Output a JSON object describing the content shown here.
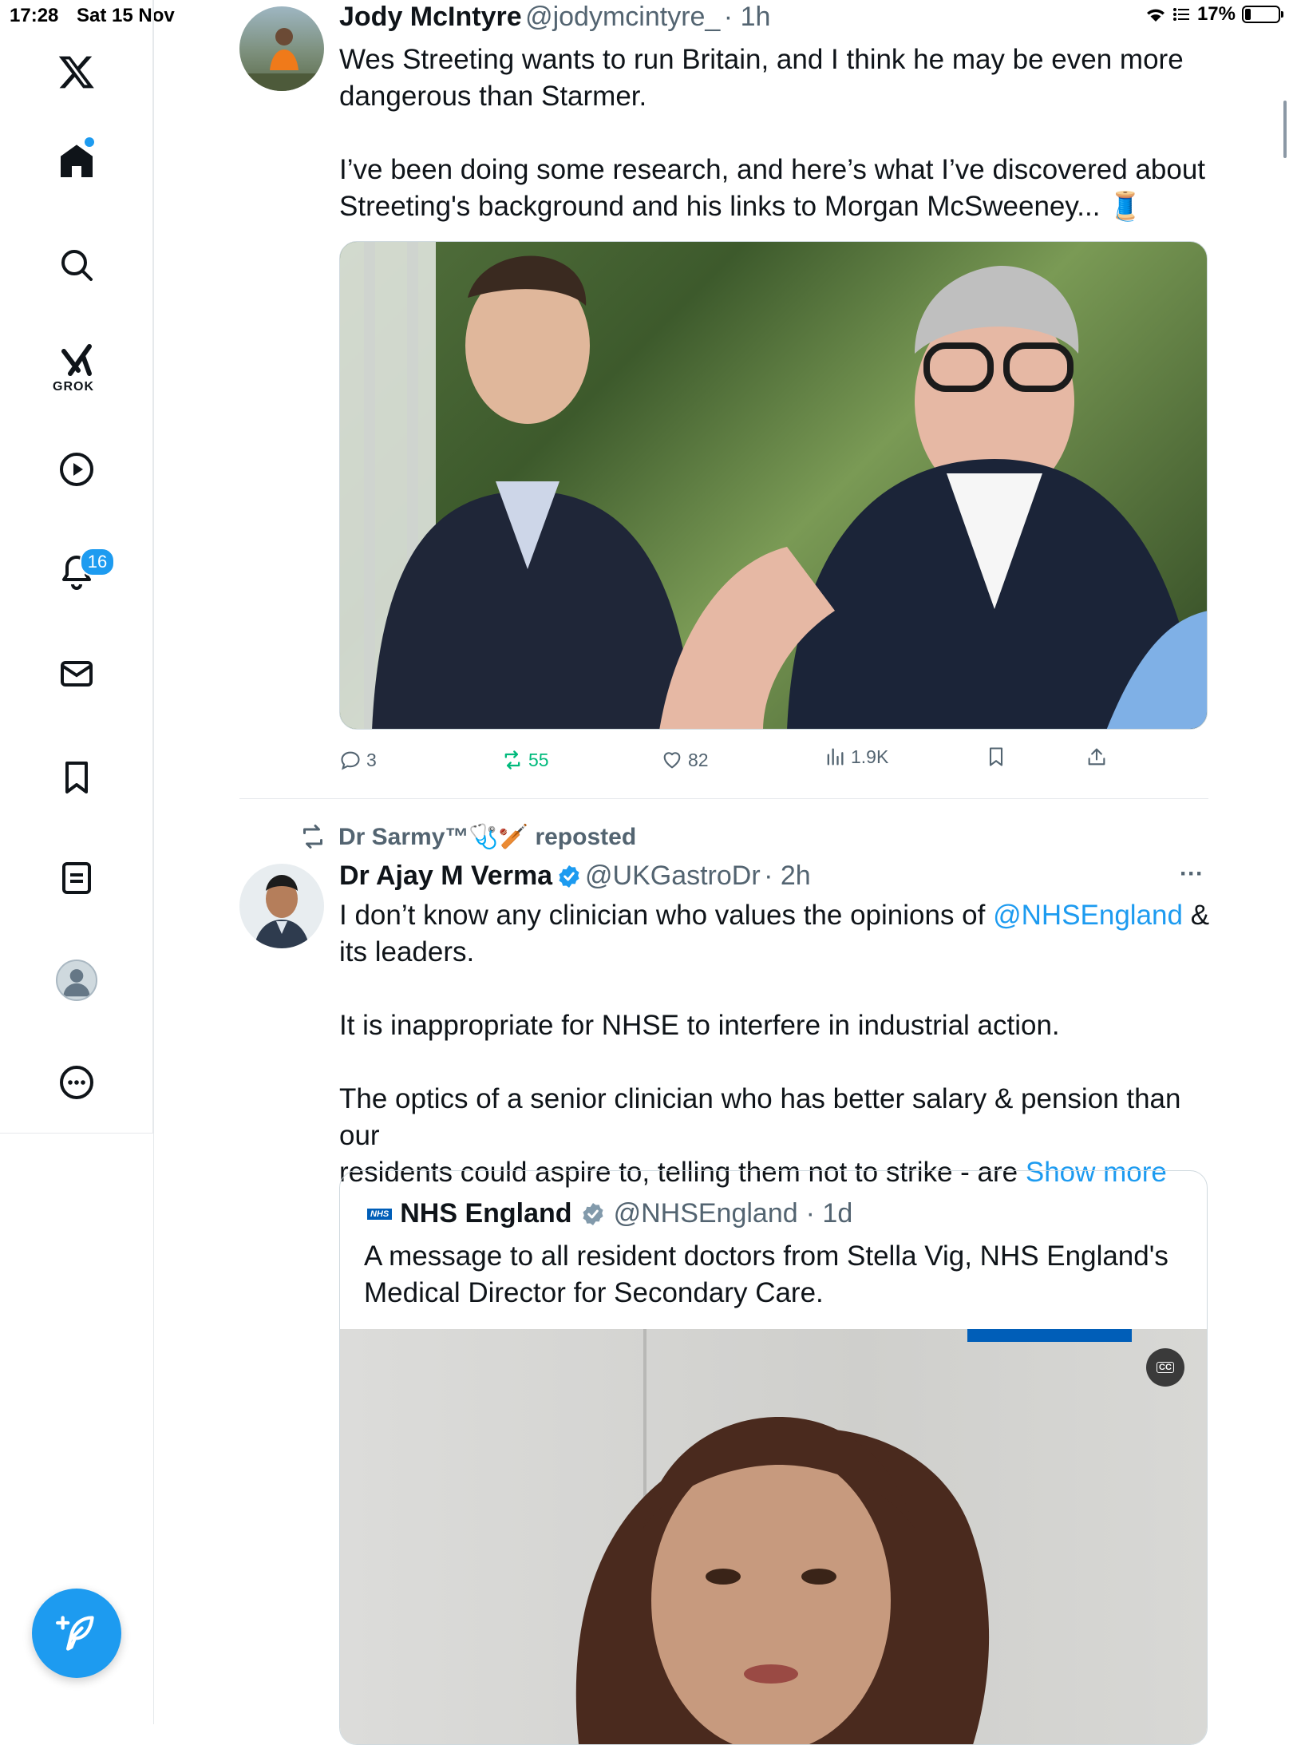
{
  "status_bar": {
    "time": "17:28",
    "date": "Sat 15 Nov",
    "battery": "17%",
    "battery_level": 0.17
  },
  "sidebar": {
    "notifications_badge": "16",
    "grok_label": "GROK"
  },
  "tweet1": {
    "name": "Jody McIntyre",
    "handle": "@jodymcintyre_",
    "time": "· 1h",
    "text_line1": "Wes Streeting wants to run Britain, and I think he may be even more",
    "text_line2": "dangerous than Starmer.",
    "text_line3": "I’ve been doing some research, and here’s what I’ve discovered about",
    "text_line4": "Streeting's background and his links to Morgan McSweeney... 🧵",
    "replies": "3",
    "reposts": "55",
    "likes": "82",
    "views": "1.9K"
  },
  "tweet2": {
    "repost_label": "Dr Sarmy™🩺🏏 reposted",
    "name": "Dr Ajay M Verma",
    "handle": "@UKGastroDr",
    "time": "· 2h",
    "line1_prefix": "I don’t know any clinician who values the opinions of ",
    "mention": "@NHSEngland",
    "line1_suffix": " &",
    "line2": "its leaders.",
    "line3": "It is inappropriate for NHSE to interfere in industrial action.",
    "line4": "The optics of a senior clinician who has better salary & pension than our",
    "line5_prefix": "residents could aspire to, telling them not to strike - are ",
    "show_more": "Show more",
    "more_menu": "···"
  },
  "quote": {
    "logo": "NHS",
    "name": "NHS England",
    "handle": "@NHSEngland",
    "time": "· 1d",
    "line1": "A message to all resident doctors from Stella Vig, NHS England's",
    "line2": "Medical Director for Secondary Care.",
    "cc": "CC"
  },
  "colors": {
    "accent": "#1d9bf0",
    "repost_green": "#00ba7c",
    "muted": "#536471"
  }
}
